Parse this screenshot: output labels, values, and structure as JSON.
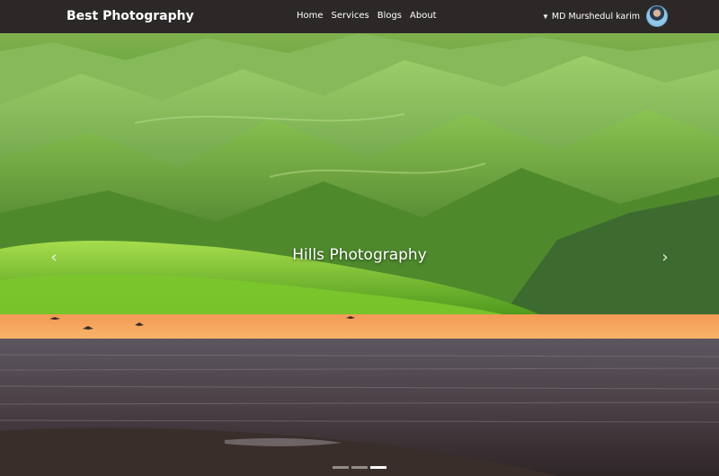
{
  "navbar": {
    "brand": "Best Photography",
    "links": [
      "Home",
      "Services",
      "Blogs",
      "About"
    ],
    "user_name": "MD Murshedul karim"
  },
  "carousel": {
    "caption": "Hills Photography",
    "prev_icon": "chevron-left-icon",
    "next_icon": "chevron-right-icon",
    "indicators": [
      {
        "active": false
      },
      {
        "active": false
      },
      {
        "active": true
      }
    ]
  },
  "colors": {
    "navbar_bg": "#2d2828",
    "hill_green": "#5f9a34",
    "sunset_orange": "#f2a25e"
  }
}
